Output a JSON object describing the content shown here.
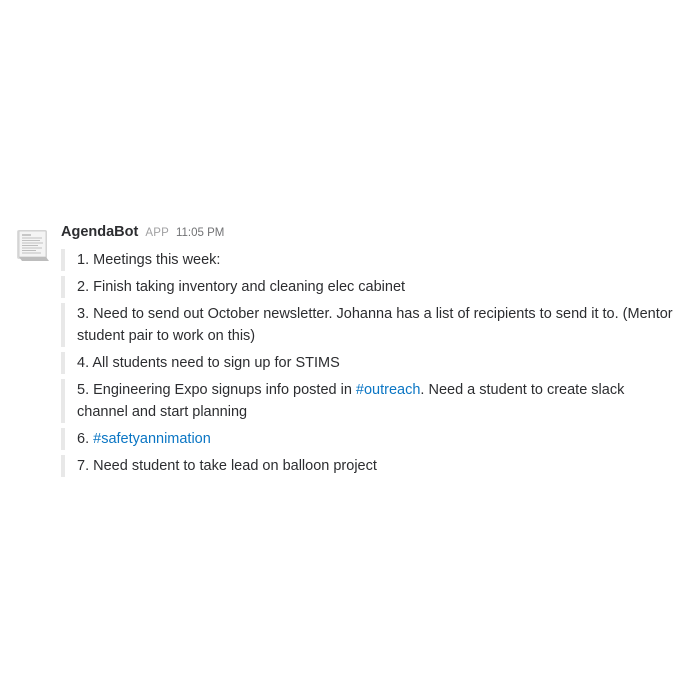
{
  "message": {
    "sender": "AgendaBot",
    "badge": "APP",
    "timestamp": "11:05 PM",
    "avatar_icon": "document-icon",
    "items": [
      {
        "text": "1. Meetings this week:"
      },
      {
        "text": "2. Finish taking inventory and cleaning elec cabinet"
      },
      {
        "text": "3. Need to send out October newsletter. Johanna has a list of recipients to send it to. (Mentor student pair to work on this)"
      },
      {
        "text": "4. All students need to sign up for STIMS"
      },
      {
        "before": "5. Engineering Expo signups info posted in ",
        "link": "#outreach",
        "after": ". Need a student to create slack channel and start planning"
      },
      {
        "before": "6. ",
        "link": "#safetyannimation"
      },
      {
        "text": "7. Need student to take lead on balloon project"
      }
    ]
  },
  "colors": {
    "link": "#0b76c4",
    "text": "#2c2d30",
    "attachment_bar": "#e8e8e8",
    "muted": "#717274"
  }
}
